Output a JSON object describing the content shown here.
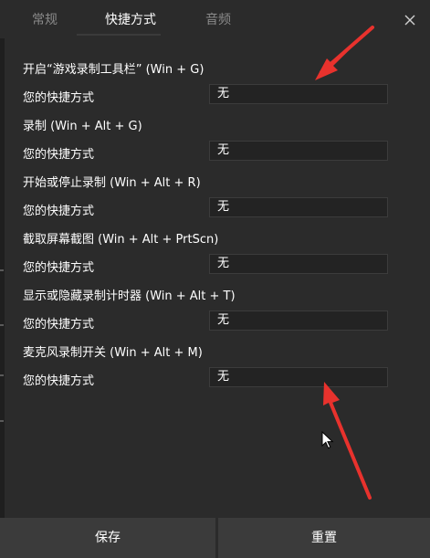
{
  "tabs": [
    {
      "label": "常规",
      "active": false
    },
    {
      "label": "快捷方式",
      "active": true
    },
    {
      "label": "音频",
      "active": false
    }
  ],
  "shortcuts": [
    {
      "title": "开启“游戏录制工具栏” (Win + G)",
      "label": "您的快捷方式",
      "value": "无"
    },
    {
      "title": "录制 (Win + Alt + G)",
      "label": "您的快捷方式",
      "value": "无"
    },
    {
      "title": "开始或停止录制 (Win + Alt + R)",
      "label": "您的快捷方式",
      "value": "无"
    },
    {
      "title": "截取屏幕截图 (Win + Alt + PrtScn)",
      "label": "您的快捷方式",
      "value": "无"
    },
    {
      "title": "显示或隐藏录制计时器 (Win + Alt + T)",
      "label": "您的快捷方式",
      "value": "无"
    },
    {
      "title": "麦克风录制开关 (Win + Alt + M)",
      "label": "您的快捷方式",
      "value": "无"
    }
  ],
  "buttons": {
    "save": "保存",
    "reset": "重置"
  },
  "colors": {
    "background": "#2b2b2b",
    "button": "#3b3b3b",
    "annotation_arrow": "#e8322d"
  }
}
